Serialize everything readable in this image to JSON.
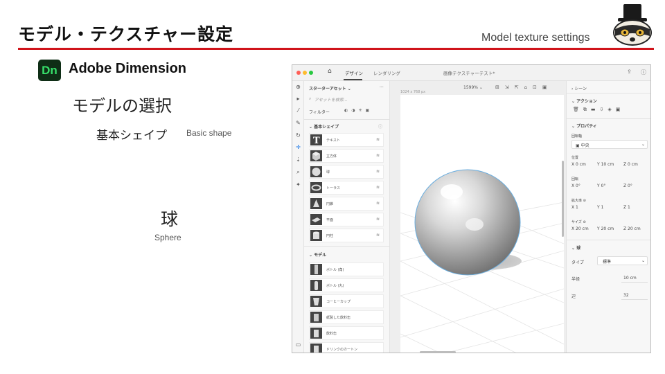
{
  "slide": {
    "title": "モデル・テクスチャー設定",
    "subtitle": "Model texture settings",
    "app_logo": "Dn",
    "app_name": "Adobe Dimension",
    "heading": "モデルの選択",
    "shape_label": "基本シェイプ",
    "shape_label_en": "Basic shape",
    "object_label": "球",
    "object_label_en": "Sphere",
    "accent_color": "#d0141b"
  },
  "window": {
    "tabs": [
      "デザイン",
      "レンダリング"
    ],
    "document_title": "画像テクスチャーテスト*",
    "share_icon": "share-icon",
    "help_icon": "help-icon"
  },
  "tools": [
    "plus-icon",
    "select-icon",
    "magic-select-icon",
    "brush-select-icon",
    "orbit-icon",
    "pan-icon",
    "dolly-icon",
    "zoom-icon",
    "sample-icon",
    "panel-icon"
  ],
  "assets": {
    "header": "スターターアセット ⌄",
    "more": "···",
    "search_placeholder": "アセットを検索...",
    "filter_label": "フィルター",
    "section_basic": "基本シェイプ",
    "basic_items": [
      "テキスト",
      "立方体",
      "球",
      "トーラス",
      "円錐",
      "平面",
      "円柱"
    ],
    "section_models": "モデル",
    "model_items": [
      "ボトル (角)",
      "ボトル (丸)",
      "コーヒーカップ",
      "紙製した飲料缶",
      "飲料缶",
      "ドリンクのカートン"
    ]
  },
  "canvas": {
    "zoom": "1599% ⌄",
    "size_label": "1024 x 768 px"
  },
  "props": {
    "scene": "シーン",
    "actions": "アクション",
    "properties": "プロパティ",
    "pivot_label": "回転軸",
    "pivot_value": "中央",
    "position_label": "位置",
    "position": [
      "X 0 cm",
      "Y 10 cm",
      "Z 0 cm"
    ],
    "rotation_label": "回転",
    "rotation": [
      "X 0°",
      "Y 0°",
      "Z 0°"
    ],
    "scale_label": "拡大率",
    "scale": [
      "X 1",
      "Y 1",
      "Z 1"
    ],
    "size_label": "サイズ",
    "size": [
      "X 20 cm",
      "Y 20 cm",
      "Z 20 cm"
    ],
    "sphere_section": "球",
    "type_label": "タイプ",
    "type_value": "標準",
    "radius_label": "半径",
    "radius_value": "10 cm",
    "sides_label": "辺",
    "sides_value": "32"
  }
}
